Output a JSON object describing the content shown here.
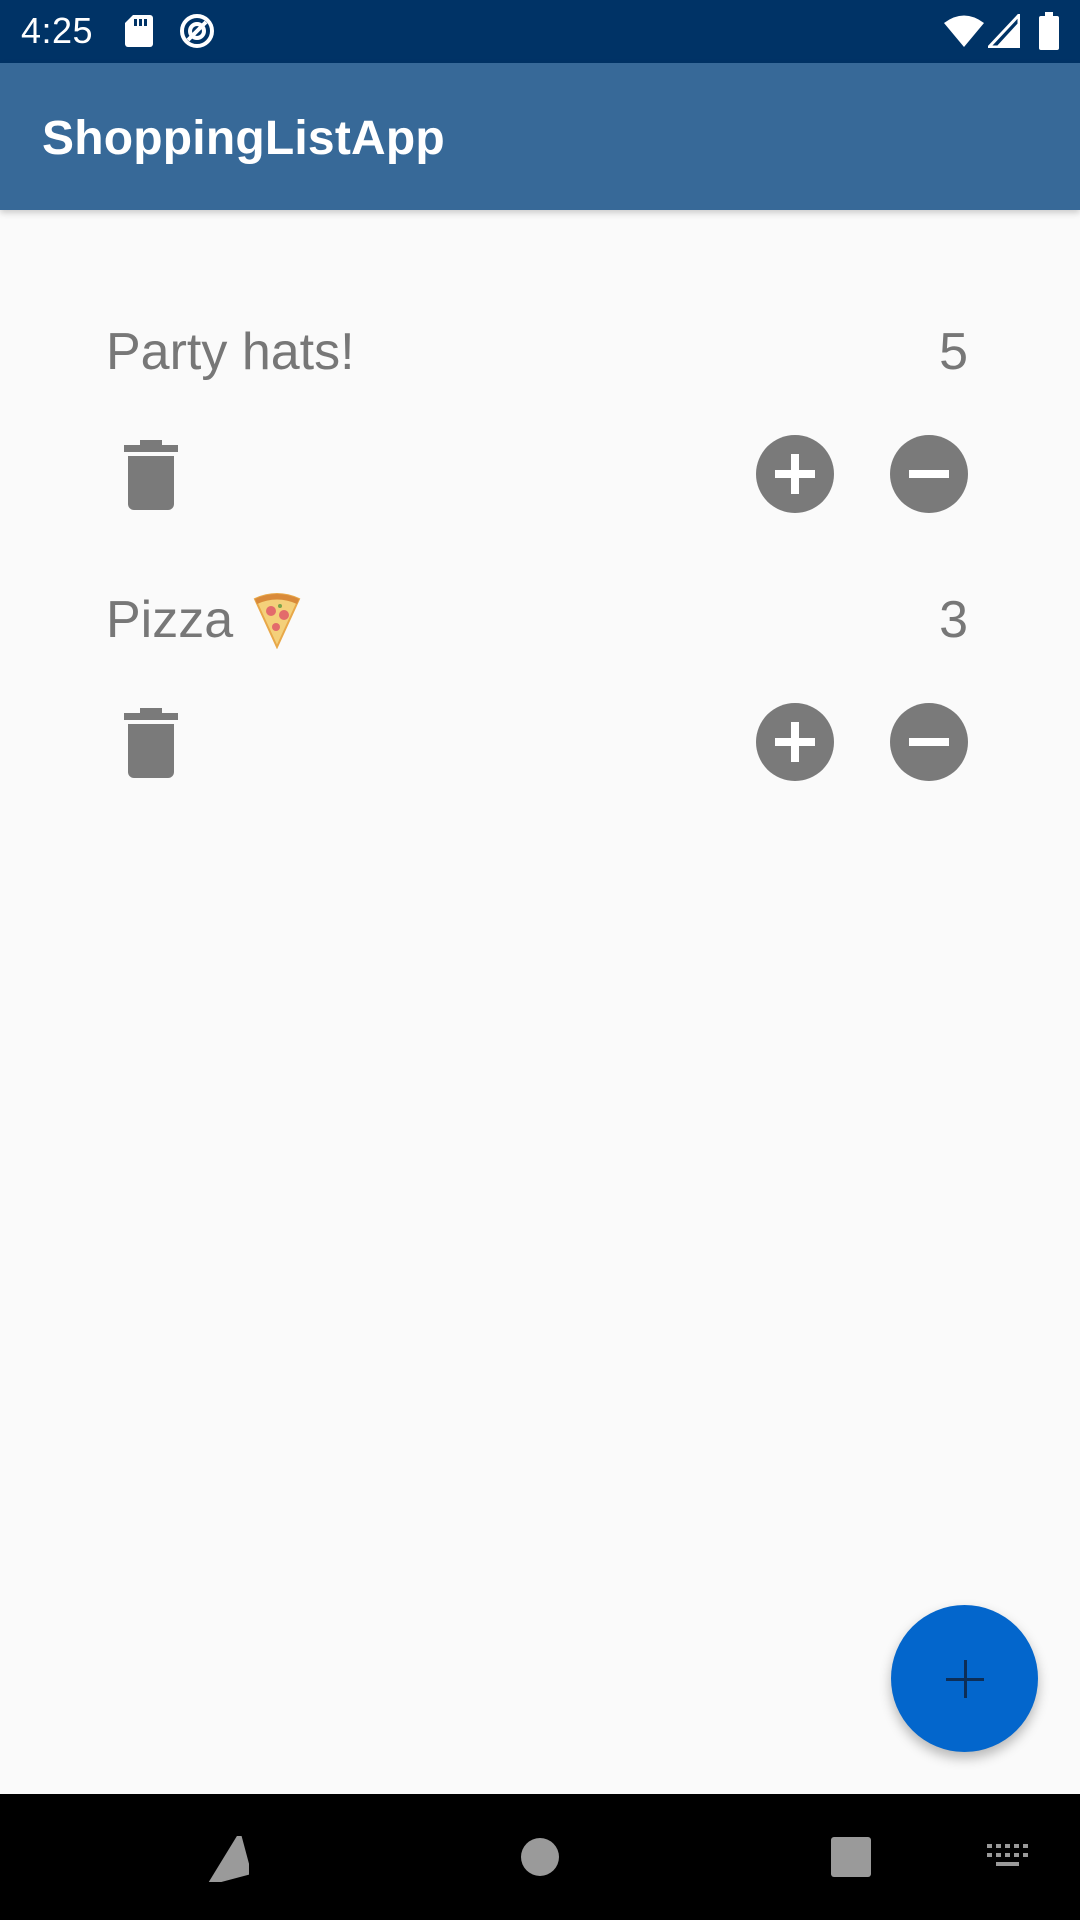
{
  "status_bar": {
    "time": "4:25",
    "icons": [
      "sd-card-icon",
      "data-saver-icon",
      "wifi-icon",
      "signal-icon",
      "battery-icon"
    ]
  },
  "app_bar": {
    "title": "ShoppingListApp",
    "background": "#376998"
  },
  "items": [
    {
      "name": "Party hats!",
      "emoji": "",
      "quantity": "5"
    },
    {
      "name": "Pizza",
      "emoji": "pizza-emoji",
      "quantity": "3"
    }
  ],
  "actions": {
    "delete_icon": "trash-icon",
    "increment_icon": "plus-circle-icon",
    "decrement_icon": "minus-circle-icon",
    "icon_color": "#7a7a7a"
  },
  "fab": {
    "icon": "plus-icon",
    "color": "#0366cc"
  },
  "nav_bar": {
    "buttons": [
      "back-icon",
      "home-icon",
      "recents-icon",
      "keyboard-icon"
    ]
  }
}
